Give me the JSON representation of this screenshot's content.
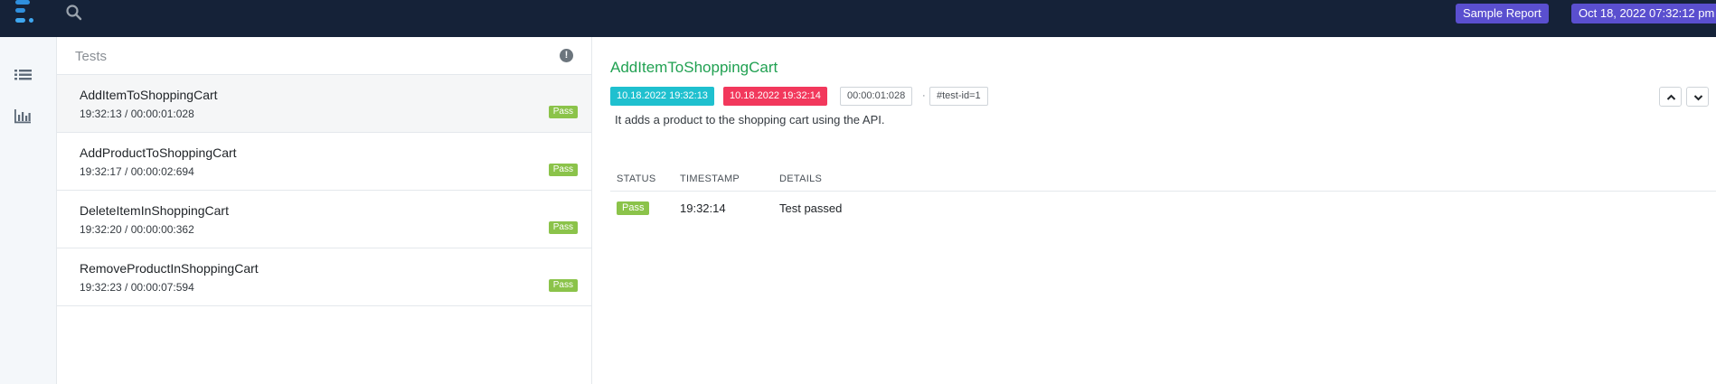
{
  "header": {
    "report_badge": "Sample Report",
    "date_badge": "Oct 18, 2022 07:32:12 pm",
    "accent_color": "#5a4fcf",
    "bar_color": "#152238"
  },
  "rail": {
    "icons": [
      "list-icon",
      "bar-chart-icon"
    ]
  },
  "tests_panel": {
    "title": "Tests",
    "items": [
      {
        "name": "AddItemToShoppingCart",
        "time": "19:32:13 / 00:00:01:028",
        "status": "Pass",
        "active": true
      },
      {
        "name": "AddProductToShoppingCart",
        "time": "19:32:17 / 00:00:02:694",
        "status": "Pass",
        "active": false
      },
      {
        "name": "DeleteItemInShoppingCart",
        "time": "19:32:20 / 00:00:00:362",
        "status": "Pass",
        "active": false
      },
      {
        "name": "RemoveProductInShoppingCart",
        "time": "19:32:23 / 00:00:07:594",
        "status": "Pass",
        "active": false
      }
    ]
  },
  "detail": {
    "title": "AddItemToShoppingCart",
    "start_time": "10.18.2022 19:32:13",
    "end_time": "10.18.2022 19:32:14",
    "duration": "00:00:01:028",
    "separator": "·",
    "test_id": "#test-id=1",
    "description": "It adds a product to the shopping cart using the API.",
    "log": {
      "columns": [
        "STATUS",
        "TIMESTAMP",
        "DETAILS"
      ],
      "rows": [
        {
          "status": "Pass",
          "timestamp": "19:32:14",
          "details": "Test passed"
        }
      ]
    }
  }
}
